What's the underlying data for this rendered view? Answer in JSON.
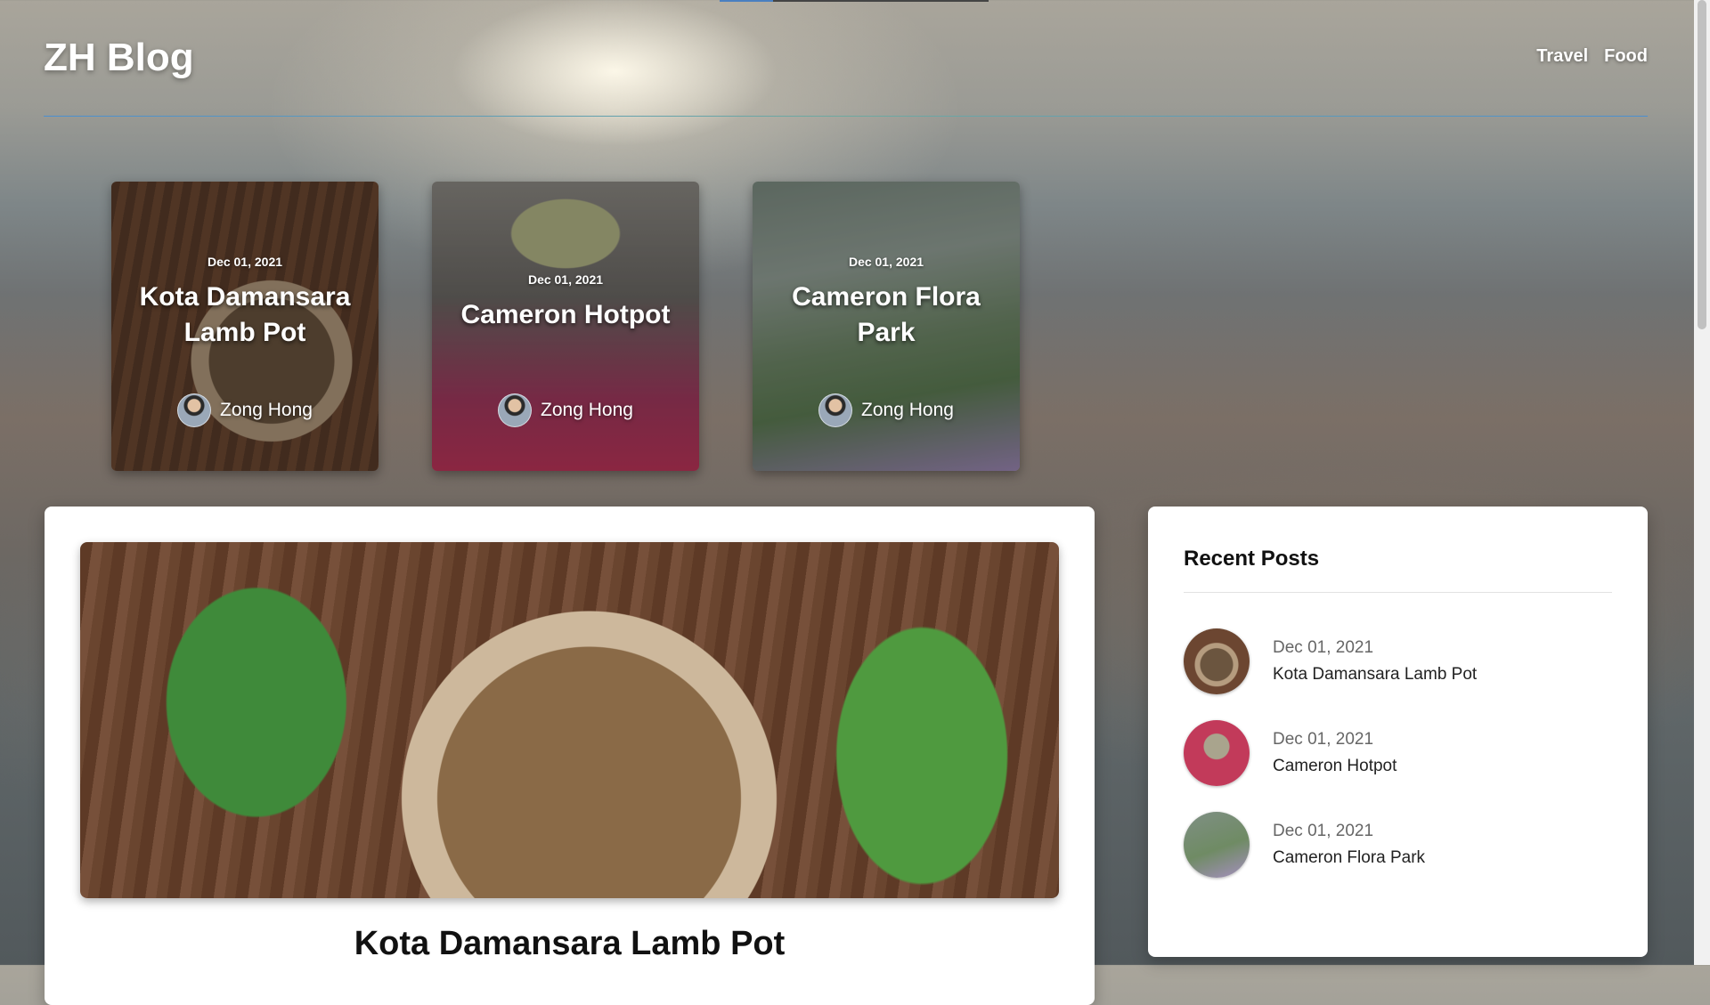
{
  "header": {
    "logo": "ZH Blog",
    "nav": [
      "Travel",
      "Food"
    ]
  },
  "featured": [
    {
      "date": "Dec 01, 2021",
      "title": "Kota Damansara Lamb Pot",
      "author": "Zong Hong"
    },
    {
      "date": "Dec 01, 2021",
      "title": "Cameron Hotpot",
      "author": "Zong Hong"
    },
    {
      "date": "Dec 01, 2021",
      "title": "Cameron Flora Park",
      "author": "Zong Hong"
    }
  ],
  "main": {
    "title": "Kota Damansara Lamb Pot"
  },
  "sidebar": {
    "title": "Recent Posts",
    "items": [
      {
        "date": "Dec 01, 2021",
        "title": "Kota Damansara Lamb Pot"
      },
      {
        "date": "Dec 01, 2021",
        "title": "Cameron Hotpot"
      },
      {
        "date": "Dec 01, 2021",
        "title": "Cameron Flora Park"
      }
    ]
  },
  "colors": {
    "accent_line": "#4b8fd0",
    "card_background": "#ffffff",
    "text_dark": "#111111"
  }
}
